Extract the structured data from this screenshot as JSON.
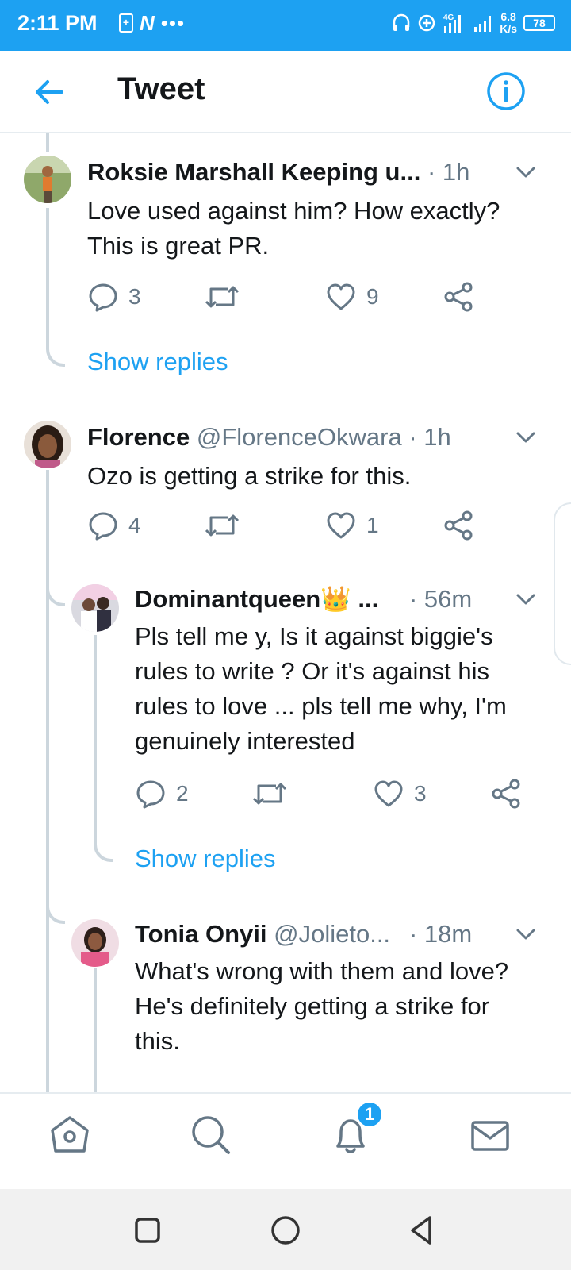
{
  "status_bar": {
    "time": "2:11 PM",
    "left_icons": [
      "plus-box-icon",
      "n-app-icon",
      "more-dots-icon"
    ],
    "n_glyph": "N",
    "dots": "•••",
    "right_icons": [
      "headset-icon",
      "data-saver-icon",
      "4g-signal-icon",
      "signal-icon"
    ],
    "speed_value": "6.8",
    "speed_unit": "K/s",
    "battery": "78"
  },
  "header": {
    "title": "Tweet",
    "back_icon": "arrow-left-icon",
    "info_icon": "info-circle-icon"
  },
  "colors": {
    "accent": "#1da1f2",
    "text": "#14171a",
    "muted": "#657786",
    "thread_line": "#ccd6dd"
  },
  "tweets": [
    {
      "name": "Roksie Marshall Keeping u...",
      "handle": "",
      "time": "· 1h",
      "text_lines": [
        "Love used against him? How exactly?",
        "This is great PR."
      ],
      "replies": "3",
      "retweets": "",
      "likes": "9",
      "show_replies": "Show replies"
    },
    {
      "name": "Florence",
      "handle": "@FlorenceOkwara",
      "time": "· 1h",
      "text_lines": [
        "Ozo is getting a strike for this."
      ],
      "replies": "4",
      "retweets": "",
      "likes": "1"
    },
    {
      "name": "Dominantqueen👑 ...",
      "handle": "",
      "time": "· 56m",
      "text_lines": [
        "Pls tell me y, Is it against biggie's",
        "rules to write ? Or it's against his",
        "rules to love ... pls tell me why, I'm",
        "genuinely interested"
      ],
      "replies": "2",
      "retweets": "",
      "likes": "3",
      "show_replies": "Show replies"
    },
    {
      "name": "Tonia Onyii",
      "handle": "@Jolieto...",
      "time": "· 18m",
      "text_lines": [
        "What's wrong with them and love?",
        "He's definitely getting a strike for",
        "this."
      ]
    }
  ],
  "bottom_nav": {
    "items": [
      "home-icon",
      "search-icon",
      "notifications-icon",
      "messages-icon"
    ],
    "notification_count": "1"
  },
  "system_nav": {
    "items": [
      "recents-square-icon",
      "home-circle-icon",
      "back-triangle-icon"
    ]
  }
}
